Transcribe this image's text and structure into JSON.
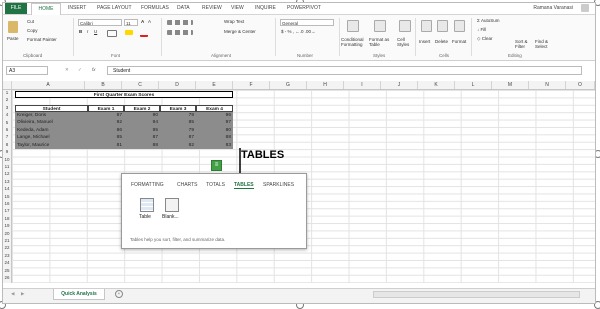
{
  "ribbon_tabs": [
    "HOME",
    "INSERT",
    "PAGE LAYOUT",
    "FORMULAS",
    "DATA",
    "REVIEW",
    "VIEW",
    "INQUIRE",
    "POWERPIVOT"
  ],
  "file_tab": "FILE",
  "user_name": "Ramana Varanasi",
  "clipboard": {
    "paste": "Paste",
    "cut": "Cut",
    "copy": "Copy",
    "format_painter": "Format Painter",
    "group": "Clipboard"
  },
  "font": {
    "name": "Calibri",
    "size": "11",
    "group": "Font"
  },
  "alignment": {
    "wrap_text": "Wrap Text",
    "merge_center": "Merge & Center",
    "group": "Alignment"
  },
  "number": {
    "format": "General",
    "group": "Number"
  },
  "styles": {
    "conditional": "Conditional Formatting",
    "format_table": "Format as Table",
    "cell_styles": "Cell Styles",
    "group": "Styles"
  },
  "cells": {
    "insert": "Insert",
    "delete": "Delete",
    "format": "Format",
    "group": "Cells"
  },
  "editing": {
    "autosum": "AutoSum",
    "fill": "Fill",
    "clear": "Clear",
    "sort_filter": "Sort & Filter",
    "find_select": "Find & Select",
    "group": "Editing"
  },
  "formula_bar": {
    "name_box": "A3",
    "fx": "fx",
    "content": "Student"
  },
  "columns": [
    "A",
    "B",
    "C",
    "D",
    "E",
    "F",
    "G",
    "H",
    "I",
    "J",
    "K",
    "L",
    "M",
    "N",
    "O",
    "P"
  ],
  "rows": [
    "1",
    "2",
    "3",
    "4",
    "5",
    "6",
    "7",
    "8",
    "9",
    "10",
    "11",
    "12",
    "13",
    "14",
    "15",
    "16",
    "17",
    "18",
    "19",
    "20",
    "21",
    "22",
    "23",
    "24",
    "25",
    "26"
  ],
  "table": {
    "title": "First Quarter Exam Scores",
    "headers": [
      "Student",
      "Exam 1",
      "Exam 2",
      "Exam 3",
      "Exam 4"
    ],
    "data": [
      [
        "Kreiger, Doris",
        "87",
        "90",
        "79",
        "96"
      ],
      [
        "Olivieira, Manuel",
        "92",
        "94",
        "85",
        "97"
      ],
      [
        "Kededa, Adam",
        "86",
        "95",
        "79",
        "80"
      ],
      [
        "Lange, Michael",
        "85",
        "87",
        "87",
        "88"
      ],
      [
        "Taylor, Maurice",
        "81",
        "88",
        "82",
        "83"
      ]
    ]
  },
  "quick_analysis": {
    "tabs": [
      "FORMATTING",
      "CHARTS",
      "TOTALS",
      "TABLES",
      "SPARKLINES"
    ],
    "active_tab": "TABLES",
    "options": [
      "Table",
      "Blank..."
    ],
    "help": "Tables help you sort, filter, and summarize data."
  },
  "annotation": "TABLES",
  "sheet_tab": "Quick Analysis",
  "colors": {
    "excel_green": "#217346",
    "selection_gray": "#8c8c8c",
    "qa_green": "#43a047"
  }
}
